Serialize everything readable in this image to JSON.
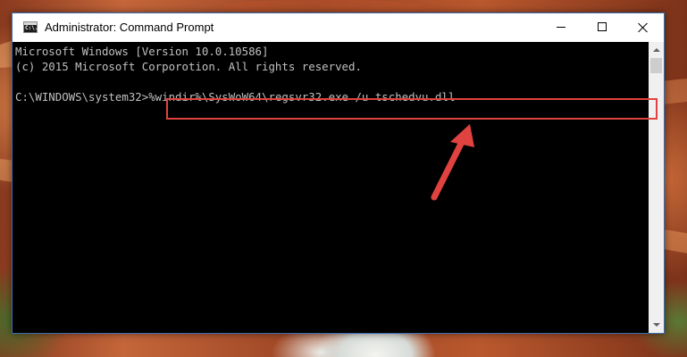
{
  "window": {
    "title": "Administrator: Command Prompt",
    "icon_text": "C:\\.",
    "controls": {
      "minimize": "minimize-icon",
      "maximize": "maximize-icon",
      "close": "close-icon"
    }
  },
  "console": {
    "lines": [
      "Microsoft Windows [Version 10.0.10586]",
      "(c) 2015 Microsoft Corporotion. All rights reserved.",
      "",
      "C:\\WINDOWS\\system32>%windir%\\SysWoW64\\regsvr32.exe /u tschedvu.dll"
    ],
    "prompt": "C:\\WINDOWS\\system32>",
    "command": "%windir%\\SysWoW64\\regsvr32.exe /u tschedvu.dll"
  },
  "annotation": {
    "highlight_color": "#e0433f",
    "arrow_color": "#e0433f"
  },
  "colors": {
    "console_bg": "#000000",
    "console_text": "#c0c0c0",
    "titlebar_bg": "#ffffff",
    "window_border": "#3a6fb0"
  }
}
